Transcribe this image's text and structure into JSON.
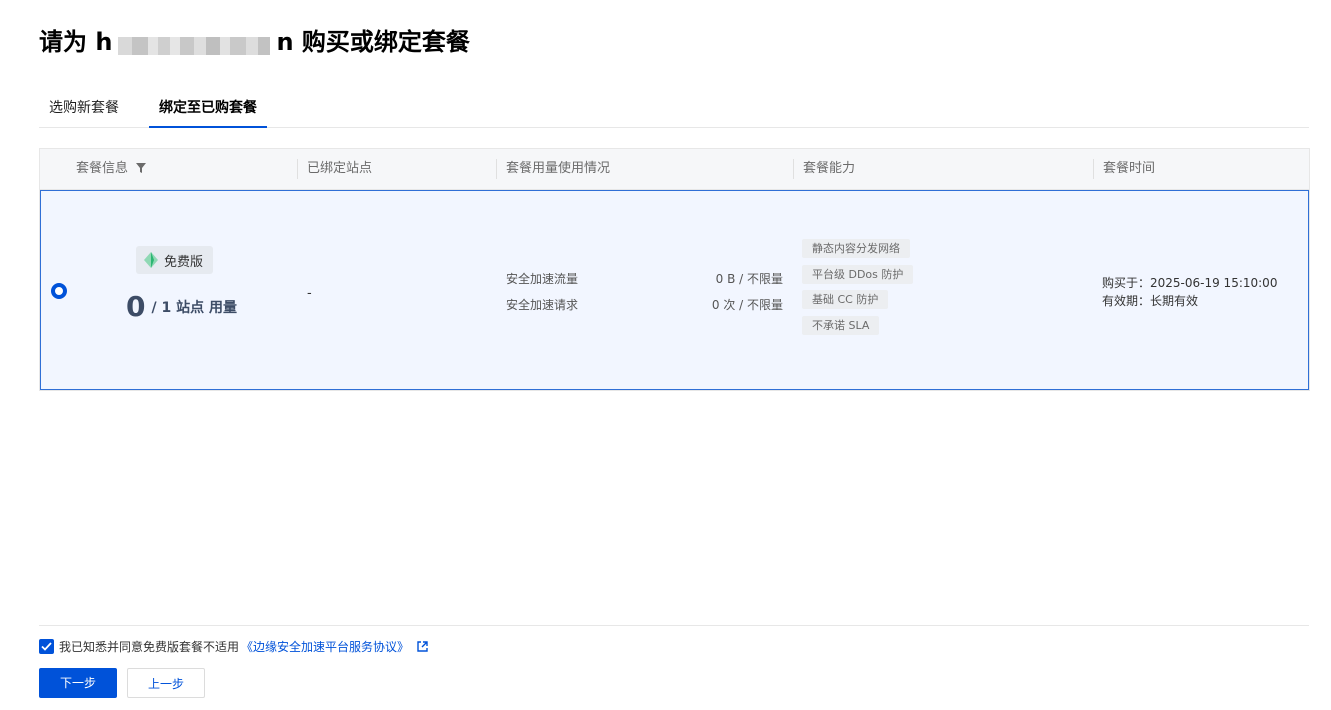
{
  "header": {
    "title_prefix": "请为 h",
    "title_suffix": "n 购买或绑定套餐"
  },
  "tabs": [
    {
      "label": "选购新套餐",
      "active": false
    },
    {
      "label": "绑定至已购套餐",
      "active": true
    }
  ],
  "table": {
    "columns": [
      "套餐信息",
      "已绑定站点",
      "套餐用量使用情况",
      "套餐能力",
      "套餐时间"
    ],
    "row": {
      "selected": true,
      "plan_badge": "免费版",
      "usage_used": "0",
      "usage_rest": "/ 1 站点 用量",
      "bound_sites": "-",
      "metrics": [
        {
          "label": "安全加速流量",
          "value": "0 B / 不限量"
        },
        {
          "label": "安全加速请求",
          "value": "0 次 / 不限量"
        }
      ],
      "features": [
        "静态内容分发网络",
        "平台级 DDos 防护",
        "基础 CC 防护",
        "不承诺 SLA"
      ],
      "purchased": "购买于：2025-06-19 15:10:00",
      "validity": "有效期：长期有效"
    }
  },
  "agreement": {
    "checked": true,
    "text": "我已知悉并同意免费版套餐不适用",
    "link": "《边缘安全加速平台服务协议》"
  },
  "buttons": {
    "next": "下一步",
    "prev": "上一步"
  },
  "colors": {
    "primary": "#0052d9",
    "row_selected_bg": "#f2f6ff",
    "badge_icon": "#2bb673"
  }
}
